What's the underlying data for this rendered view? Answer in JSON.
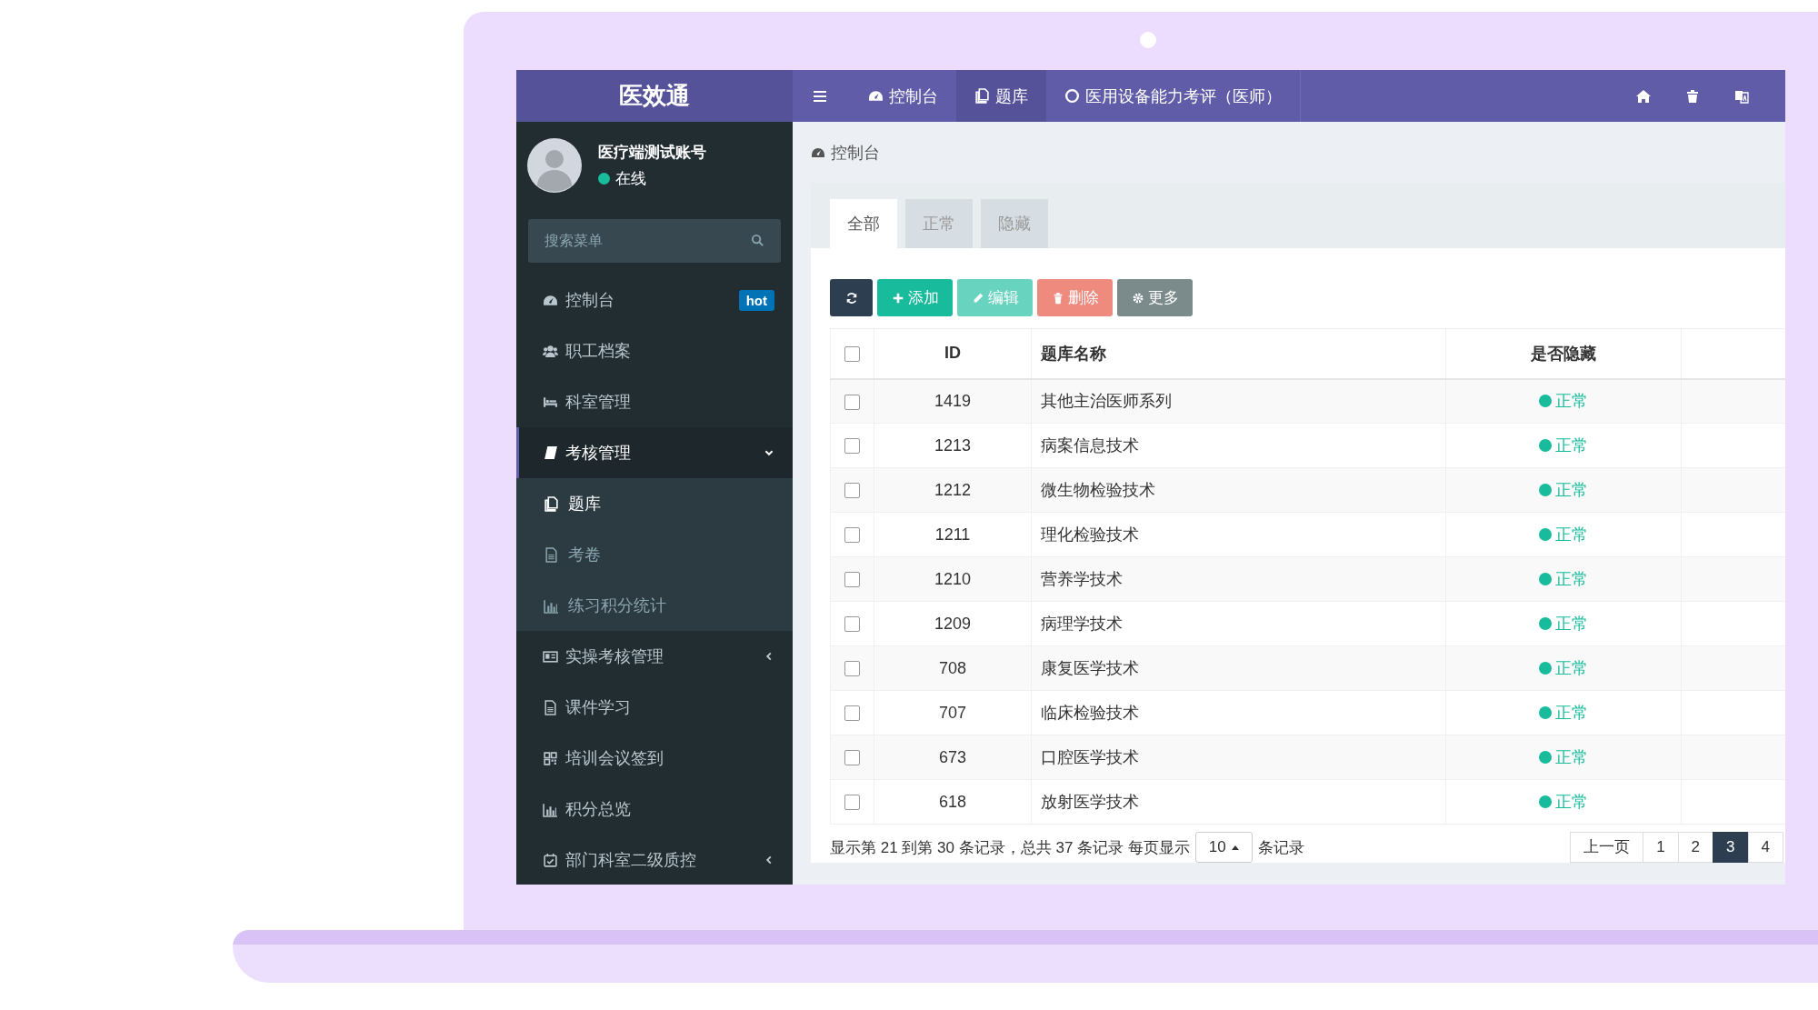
{
  "header": {
    "logo": "医效通",
    "nav": [
      {
        "label": "控制台",
        "selected": false
      },
      {
        "label": "题库",
        "selected": true
      },
      {
        "label": "医用设备能力考评（医师）",
        "selected": false
      }
    ]
  },
  "sidebar": {
    "user": {
      "name": "医疗端测试账号",
      "status": "在线"
    },
    "search": {
      "placeholder": "搜索菜单"
    },
    "items": [
      {
        "label": "控制台",
        "kind": "link",
        "selected": false,
        "badge": "hot"
      },
      {
        "label": "职工档案",
        "kind": "link",
        "selected": false
      },
      {
        "label": "科室管理",
        "kind": "link",
        "selected": false
      },
      {
        "label": "考核管理",
        "kind": "group",
        "selected": true,
        "expanded": true,
        "children": [
          {
            "label": "题库",
            "selected": true
          },
          {
            "label": "考卷",
            "selected": false
          },
          {
            "label": "练习积分统计",
            "selected": false
          }
        ]
      },
      {
        "label": "实操考核管理",
        "kind": "group",
        "selected": false,
        "expanded": false
      },
      {
        "label": "课件学习",
        "kind": "link",
        "selected": false
      },
      {
        "label": "培训会议签到",
        "kind": "link",
        "selected": false
      },
      {
        "label": "积分总览",
        "kind": "link",
        "selected": false
      },
      {
        "label": "部门科室二级质控",
        "kind": "group",
        "selected": false,
        "expanded": false
      }
    ]
  },
  "breadcrumb": "控制台",
  "tabs": [
    {
      "label": "全部",
      "selected": true
    },
    {
      "label": "正常",
      "selected": false
    },
    {
      "label": "隐藏",
      "selected": false
    }
  ],
  "toolbar": [
    {
      "kind": "refresh",
      "disabled": false
    },
    {
      "kind": "add",
      "label": "添加",
      "disabled": false
    },
    {
      "kind": "edit",
      "label": "编辑",
      "disabled": true
    },
    {
      "kind": "delete",
      "label": "删除",
      "disabled": true
    },
    {
      "kind": "more",
      "label": "更多",
      "disabled": false
    }
  ],
  "table": {
    "select_all": false,
    "columns": [
      "ID",
      "题库名称",
      "是否隐藏"
    ],
    "rows": [
      {
        "checked": false,
        "id": "1419",
        "name": "其他主治医师系列",
        "status": "正常"
      },
      {
        "checked": false,
        "id": "1213",
        "name": "病案信息技术",
        "status": "正常"
      },
      {
        "checked": false,
        "id": "1212",
        "name": "微生物检验技术",
        "status": "正常"
      },
      {
        "checked": false,
        "id": "1211",
        "name": "理化检验技术",
        "status": "正常"
      },
      {
        "checked": false,
        "id": "1210",
        "name": "营养学技术",
        "status": "正常"
      },
      {
        "checked": false,
        "id": "1209",
        "name": "病理学技术",
        "status": "正常"
      },
      {
        "checked": false,
        "id": "708",
        "name": "康复医学技术",
        "status": "正常"
      },
      {
        "checked": false,
        "id": "707",
        "name": "临床检验技术",
        "status": "正常"
      },
      {
        "checked": false,
        "id": "673",
        "name": "口腔医学技术",
        "status": "正常"
      },
      {
        "checked": false,
        "id": "618",
        "name": "放射医学技术",
        "status": "正常"
      }
    ]
  },
  "pagination": {
    "summary": "显示第 21 到第 30 条记录，总共 37 条记录 每页显示",
    "page_size": "10",
    "suffix": "条记录",
    "pages": [
      {
        "label": "上一页",
        "selected": false
      },
      {
        "label": "1",
        "selected": false
      },
      {
        "label": "2",
        "selected": false
      },
      {
        "label": "3",
        "selected": true
      },
      {
        "label": "4",
        "selected": false
      }
    ]
  }
}
